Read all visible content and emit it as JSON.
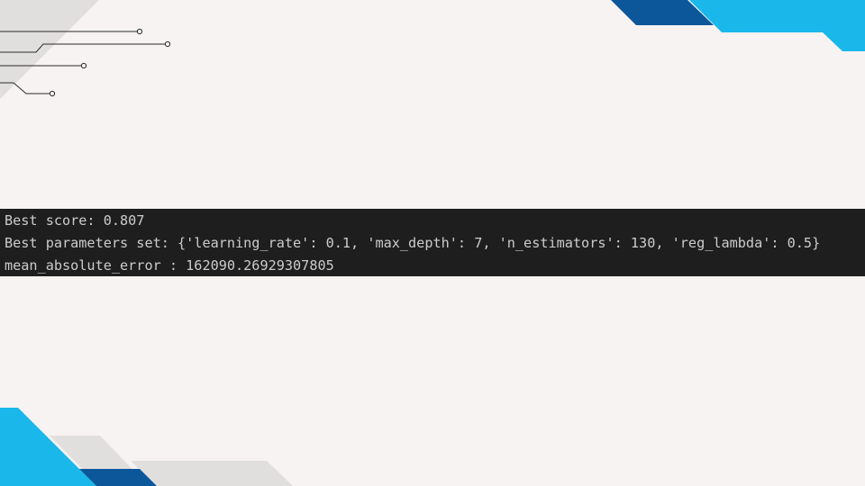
{
  "theme": {
    "background": "#f6f3f2",
    "terminal_background": "#1e1e1e",
    "terminal_text": "#cccccc",
    "accent_dark_blue": "#0c579a",
    "accent_light_blue": "#1ab7ea",
    "accent_gray": "#e1dfde",
    "circuit_line": "#2b2b2b"
  },
  "decorations": {
    "top_left": "circuit-lines",
    "top_right": "blue-corner-stripes",
    "bottom_left": "blue-gray-corner-stripes"
  },
  "terminal": {
    "lines": [
      "Best score: 0.807",
      "Best parameters set: {'learning_rate': 0.1, 'max_depth': 7, 'n_estimators': 130, 'reg_lambda': 0.5}",
      "mean_absolute_error : 162090.26929307805"
    ]
  }
}
